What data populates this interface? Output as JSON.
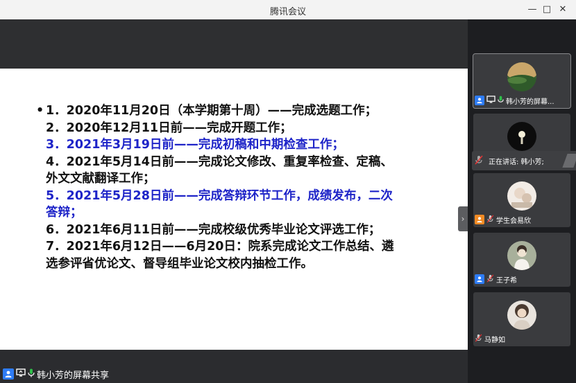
{
  "window": {
    "title": "腾讯会议",
    "minimize": "—",
    "maximize": "□",
    "close": "✕"
  },
  "share": {
    "label": "韩小芳的屏幕共享",
    "slide_lines": [
      {
        "text": "1．2020年11月20日（本学期第十周）——完成选题工作；",
        "color": "#111111",
        "bullet": true
      },
      {
        "text": "2．2020年12月11日前——完成开题工作；",
        "color": "#111111"
      },
      {
        "text": "3．2021年3月19日前——完成初稿和中期检查工作；",
        "color": "#1e24c8"
      },
      {
        "text": "4．2021年5月14日前——完成论文修改、重复率检查、定稿、",
        "color": "#111111"
      },
      {
        "text": "外文文献翻译工作；",
        "color": "#111111",
        "wrap": true
      },
      {
        "text": "5．2021年5月28日前——完成答辩环节工作，成绩发布，二次",
        "color": "#1e24c8"
      },
      {
        "text": "答辩；",
        "color": "#1e24c8",
        "wrap": true
      },
      {
        "text": "6．2021年6月11日前——完成校级优秀毕业论文评选工作；",
        "color": "#111111"
      },
      {
        "text": "7．2021年6月12日——6月20日：院系完成论文工作总结、遴",
        "color": "#111111"
      },
      {
        "text": "选参评省优论文、督导组毕业论文校内抽检工作。",
        "color": "#111111",
        "wrap": true
      }
    ]
  },
  "panel": {
    "speaking_text": "正在讲话: 韩小芳;",
    "tiles": [
      {
        "name": "韩小芳的屏幕...",
        "badge": "blue"
      },
      {
        "name": "",
        "badge": "none"
      },
      {
        "name": "学生会易欣",
        "badge": "orange"
      },
      {
        "name": "王子希",
        "badge": "blue"
      },
      {
        "name": "马静如",
        "badge": "none"
      }
    ]
  },
  "colors": {
    "accent_blue": "#2e7cf6",
    "accent_orange": "#f08a24",
    "slide_blue_text": "#1e24c8"
  }
}
